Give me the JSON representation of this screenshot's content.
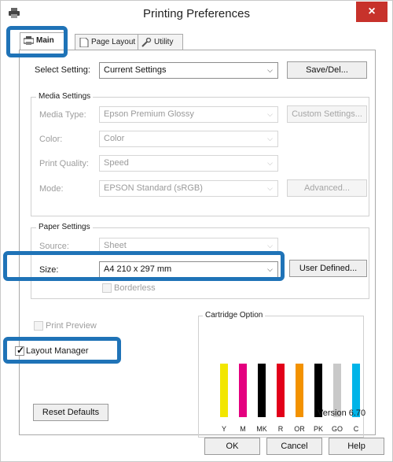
{
  "window": {
    "title": "Printing Preferences",
    "close_glyph": "×"
  },
  "tabs": [
    {
      "label": "Main",
      "icon": "printer-icon"
    },
    {
      "label": "Page Layout",
      "icon": "page-icon"
    },
    {
      "label": "Utility",
      "icon": "wrench-icon"
    }
  ],
  "select_setting": {
    "label": "Select Setting:",
    "value": "Current Settings",
    "button": "Save/Del..."
  },
  "media": {
    "group_title": "Media Settings",
    "type_label": "Media Type:",
    "type_value": "Epson Premium Glossy",
    "custom_button": "Custom Settings...",
    "color_label": "Color:",
    "color_value": "Color",
    "quality_label": "Print Quality:",
    "quality_value": "Speed",
    "mode_label": "Mode:",
    "mode_value": "EPSON Standard (sRGB)",
    "advanced_button": "Advanced..."
  },
  "paper": {
    "group_title": "Paper Settings",
    "source_label": "Source:",
    "source_value": "Sheet",
    "size_label": "Size:",
    "size_value": "A4 210 x 297 mm",
    "user_defined_button": "User Defined...",
    "borderless_label": "Borderless"
  },
  "options": {
    "print_preview_label": "Print Preview",
    "print_preview_checked": false,
    "layout_manager_label": "Layout Manager",
    "layout_manager_checked": true,
    "check_glyph": "✓"
  },
  "cartridge": {
    "group_title": "Cartridge Option",
    "inks": [
      {
        "label": "Y",
        "color": "#f2e600"
      },
      {
        "label": "M",
        "color": "#e4007f"
      },
      {
        "label": "MK",
        "color": "#000000"
      },
      {
        "label": "R",
        "color": "#e2001a"
      },
      {
        "label": "OR",
        "color": "#f39200"
      },
      {
        "label": "PK",
        "color": "#000000"
      },
      {
        "label": "GO",
        "color": "#c9c9c9"
      },
      {
        "label": "C",
        "color": "#00b4e8"
      }
    ]
  },
  "footer": {
    "reset_button": "Reset Defaults",
    "version": "Version 6.70",
    "ok_button": "OK",
    "cancel_button": "Cancel",
    "help_button": "Help"
  },
  "colors": {
    "highlight": "#1f73b7",
    "close": "#c7322b"
  }
}
